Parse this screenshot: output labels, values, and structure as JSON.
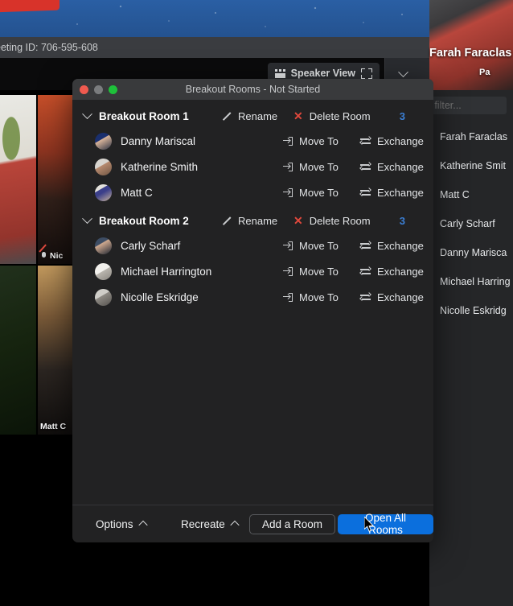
{
  "meeting": {
    "meeting_id_text": "eeting ID: 706-595-608",
    "recording_badge": "rec-badge",
    "toolbar": {
      "view_button_label": "Speaker View",
      "view_icon": "grid-icon",
      "fullscreen_icon": "expand-icon",
      "chevron_icon": "chevron-down-icon"
    },
    "thumbnails": [
      {
        "name": "",
        "muted": false,
        "active_speaker": true
      },
      {
        "name": "Nic",
        "muted": true,
        "active_speaker": false
      },
      {
        "name": "",
        "muted": false,
        "active_speaker": false
      },
      {
        "name": "Matt C",
        "muted": false,
        "active_speaker": false
      }
    ],
    "active_video": {
      "name_label": "Farah Faraclas",
      "sub_label": "Pa"
    }
  },
  "participants_panel": {
    "filter_placeholder": "e to filter...",
    "items": [
      {
        "name": "Farah Faraclas"
      },
      {
        "name": "Katherine Smit"
      },
      {
        "name": "Matt C"
      },
      {
        "name": "Carly Scharf"
      },
      {
        "name": "Danny Marisca"
      },
      {
        "name": "Michael Harring"
      },
      {
        "name": "Nicolle Eskridg"
      }
    ]
  },
  "dialog": {
    "title": "Breakout Rooms - Not Started",
    "window_controls": {
      "close": "close-button",
      "minimize": "minimize-button",
      "maximize": "maximize-button"
    },
    "labels": {
      "rename": "Rename",
      "delete_room": "Delete Room",
      "move_to": "Move To",
      "exchange": "Exchange"
    },
    "rooms": [
      {
        "name": "Breakout Room 1",
        "count": "3",
        "participants": [
          {
            "name": "Danny Mariscal"
          },
          {
            "name": "Katherine Smith"
          },
          {
            "name": "Matt C"
          }
        ]
      },
      {
        "name": "Breakout Room 2",
        "count": "3",
        "participants": [
          {
            "name": "Carly Scharf"
          },
          {
            "name": "Michael Harrington"
          },
          {
            "name": "Nicolle Eskridge"
          }
        ]
      }
    ],
    "footer": {
      "options": "Options",
      "recreate": "Recreate",
      "add_room": "Add a Room",
      "open_all_rooms": "Open All Rooms"
    }
  },
  "colors": {
    "accent_blue": "#0b6fdd",
    "count_blue": "#3b7fd4",
    "delete_red": "#e0483c",
    "dialog_bg": "#222223",
    "titlebar_bg": "#393a3c",
    "active_speaker_border": "#c9e265"
  }
}
